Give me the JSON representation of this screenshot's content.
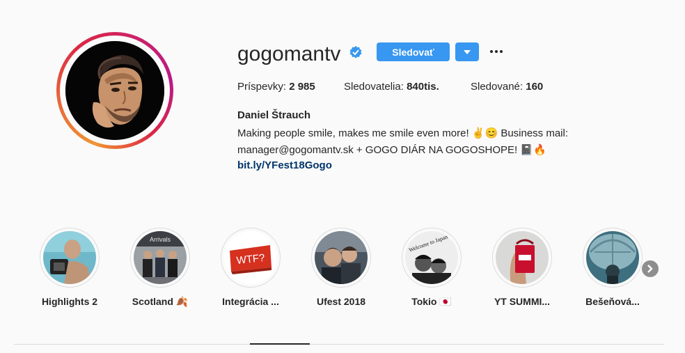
{
  "profile": {
    "username": "gogomantv",
    "verified": true,
    "follow_label": "Sledovať",
    "stats": {
      "posts_label": "Príspevky:",
      "posts_value": "2 985",
      "followers_label": "Sledovatelia:",
      "followers_value": "840tis.",
      "following_label": "Sledované:",
      "following_value": "160"
    },
    "full_name": "Daniel Štrauch",
    "bio_line1": "Making people smile, makes me smile even more! ✌️😊 Business mail:",
    "bio_line2": "manager@gogomantv.sk + GOGO DIÁR NA GOGOSHOPE! 📓🔥",
    "link": "bit.ly/YFest18Gogo"
  },
  "highlights": [
    {
      "label": "Highlights 2"
    },
    {
      "label": "Scotland 🍂"
    },
    {
      "label": "Integrácia ..."
    },
    {
      "label": "Ufest 2018"
    },
    {
      "label": "Tokio 🇯🇵"
    },
    {
      "label": "YT SUMMI..."
    },
    {
      "label": "Bešeňová..."
    }
  ],
  "highlight_wtf_text": "WTF?",
  "highlight_scotland_sign": "Arrivals",
  "highlight_tokio_sign": "Welcome to Japan",
  "icons": {
    "verified": "verified-badge-icon",
    "dropdown": "chevron-down-icon",
    "more": "more-options-icon",
    "next": "chevron-right-icon"
  },
  "colors": {
    "accent": "#3897f0",
    "link": "#003569",
    "text": "#262626",
    "border": "#dbdbdb"
  }
}
